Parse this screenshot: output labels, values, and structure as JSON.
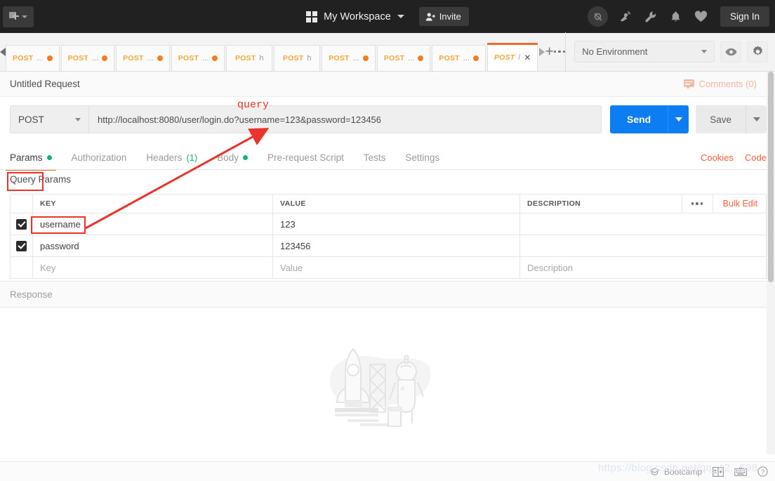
{
  "topbar": {
    "new_button": "New",
    "workspace_name": "My Workspace",
    "invite_label": "Invite",
    "signin_label": "Sign In",
    "icons": [
      "sync-off-icon",
      "satellite-icon",
      "wrench-icon",
      "bell-icon",
      "heart-icon"
    ]
  },
  "tabstrip": {
    "tabs": [
      {
        "method": "POST",
        "url": "...",
        "dirty": true,
        "active": false
      },
      {
        "method": "POST",
        "url": "...",
        "dirty": true,
        "active": false
      },
      {
        "method": "POST",
        "url": "...",
        "dirty": true,
        "active": false
      },
      {
        "method": "POST",
        "url": "...",
        "dirty": true,
        "active": false
      },
      {
        "method": "POST",
        "url": "h",
        "dirty": false,
        "active": false
      },
      {
        "method": "POST",
        "url": "h",
        "dirty": false,
        "active": false
      },
      {
        "method": "POST",
        "url": "...",
        "dirty": true,
        "active": false
      },
      {
        "method": "POST",
        "url": "...",
        "dirty": true,
        "active": false
      },
      {
        "method": "POST",
        "url": "...",
        "dirty": true,
        "active": false
      },
      {
        "method": "POST",
        "url": "/",
        "dirty": false,
        "active": true,
        "close": "✕"
      }
    ],
    "add_label": "+",
    "environment": "No Environment"
  },
  "request": {
    "title": "Untitled Request",
    "comments_label": "Comments (0)",
    "method": "POST",
    "url": "http://localhost:8080/user/login.do?username=123&password=123456",
    "send_label": "Send",
    "save_label": "Save"
  },
  "subtabs": {
    "items": [
      {
        "label": "Params",
        "dot": true,
        "count": "",
        "active": true
      },
      {
        "label": "Authorization",
        "dot": false,
        "count": "",
        "active": false
      },
      {
        "label": "Headers",
        "dot": false,
        "count": "(1)",
        "active": false
      },
      {
        "label": "Body",
        "dot": true,
        "count": "",
        "active": false
      },
      {
        "label": "Pre-request Script",
        "dot": false,
        "count": "",
        "active": false
      },
      {
        "label": "Tests",
        "dot": false,
        "count": "",
        "active": false
      },
      {
        "label": "Settings",
        "dot": false,
        "count": "",
        "active": false
      }
    ],
    "cookies_label": "Cookies",
    "code_label": "Code"
  },
  "params": {
    "section_title": "Query Params",
    "headers": {
      "key": "KEY",
      "value": "VALUE",
      "description": "DESCRIPTION"
    },
    "bulk_edit_label": "Bulk Edit",
    "rows": [
      {
        "checked": true,
        "key": "username",
        "value": "123",
        "description": ""
      },
      {
        "checked": true,
        "key": "password",
        "value": "123456",
        "description": ""
      }
    ],
    "placeholder_row": {
      "key": "Key",
      "value": "Value",
      "description": "Description"
    }
  },
  "response": {
    "label": "Response",
    "illustration": "rocket-astronaut-illustration"
  },
  "bottombar": {
    "bootcamp_label": "Bootcamp",
    "watermark": "https://blog.csdn.net/qq_42...598"
  },
  "annotations": {
    "query_text": "query"
  },
  "colors": {
    "accent_orange": "#f06a28",
    "send_blue": "#0d7ef2",
    "green_dot": "#14b07f",
    "annotation_red": "#e8342a",
    "topbar_dark": "#212121"
  }
}
